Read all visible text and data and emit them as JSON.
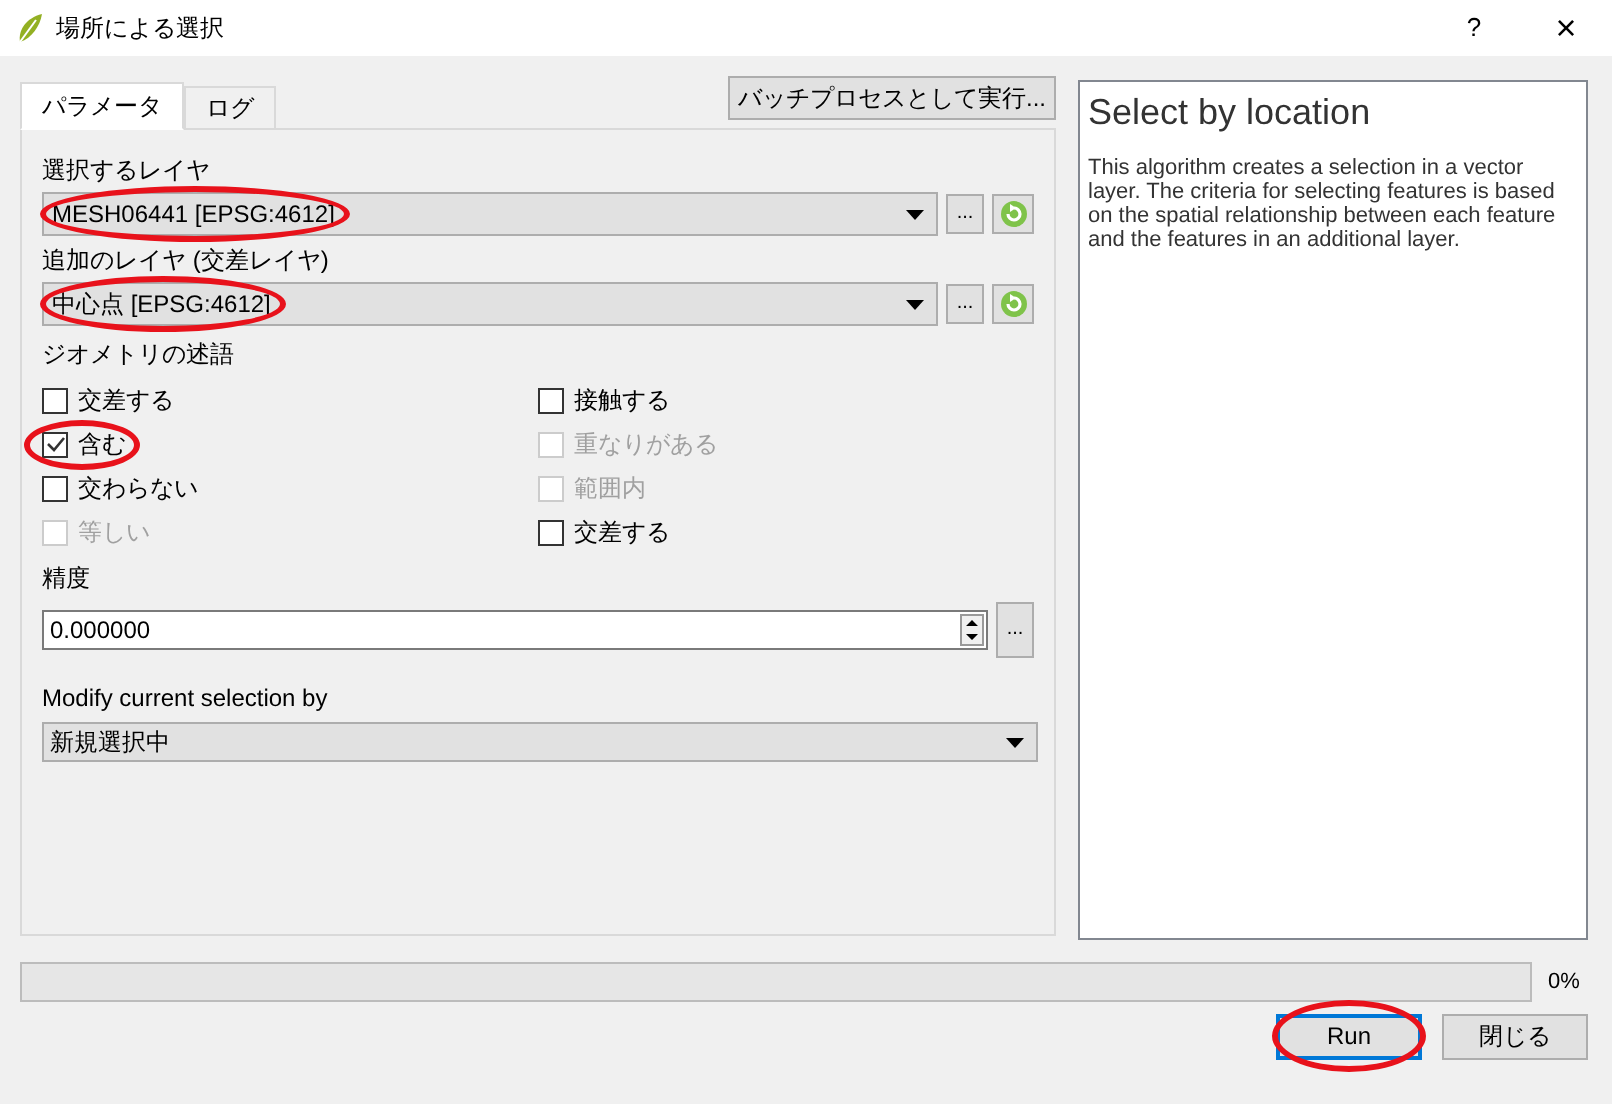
{
  "window": {
    "title": "場所による選択",
    "help_button": "?",
    "close_button": "×"
  },
  "tabs": [
    {
      "label": "パラメータ",
      "selected": true
    },
    {
      "label": "ログ",
      "selected": false
    }
  ],
  "batch_button": "バッチプロセスとして実行...",
  "input_layer": {
    "label": "選択するレイヤ",
    "value": "MESH06441 [EPSG:4612]",
    "highlighted": true,
    "browse_button": "..."
  },
  "intersect_layer": {
    "label": "追加のレイヤ (交差レイヤ)",
    "value": "中心点 [EPSG:4612]",
    "highlighted": true,
    "browse_button": "..."
  },
  "predicates": {
    "label": "ジオメトリの述語",
    "options": [
      {
        "label": "交差する",
        "checked": false,
        "disabled": false,
        "highlighted": false
      },
      {
        "label": "接触する",
        "checked": false,
        "disabled": false,
        "highlighted": false
      },
      {
        "label": "含む",
        "checked": true,
        "disabled": false,
        "highlighted": true
      },
      {
        "label": "重なりがある",
        "checked": false,
        "disabled": true,
        "highlighted": false
      },
      {
        "label": "交わらない",
        "checked": false,
        "disabled": false,
        "highlighted": false
      },
      {
        "label": "範囲内",
        "checked": false,
        "disabled": true,
        "highlighted": false
      },
      {
        "label": "等しい",
        "checked": false,
        "disabled": true,
        "highlighted": false
      },
      {
        "label": "交差する",
        "checked": false,
        "disabled": false,
        "highlighted": false
      }
    ]
  },
  "precision": {
    "label": "精度",
    "value": "0.000000",
    "browse_button": "..."
  },
  "modify_selection": {
    "label": "Modify current selection by",
    "value": "新規選択中"
  },
  "help": {
    "title": "Select by location",
    "text": "This algorithm creates a selection in a vector layer. The criteria for selecting features is based on the spatial relationship between each feature and the features in an additional layer."
  },
  "progress": {
    "level": 0,
    "reading": "0%"
  },
  "buttons": [
    {
      "label": "Run",
      "kind": "primary",
      "highlighted": true
    },
    {
      "label": "閉じる",
      "kind": "normal",
      "highlighted": false
    }
  ]
}
